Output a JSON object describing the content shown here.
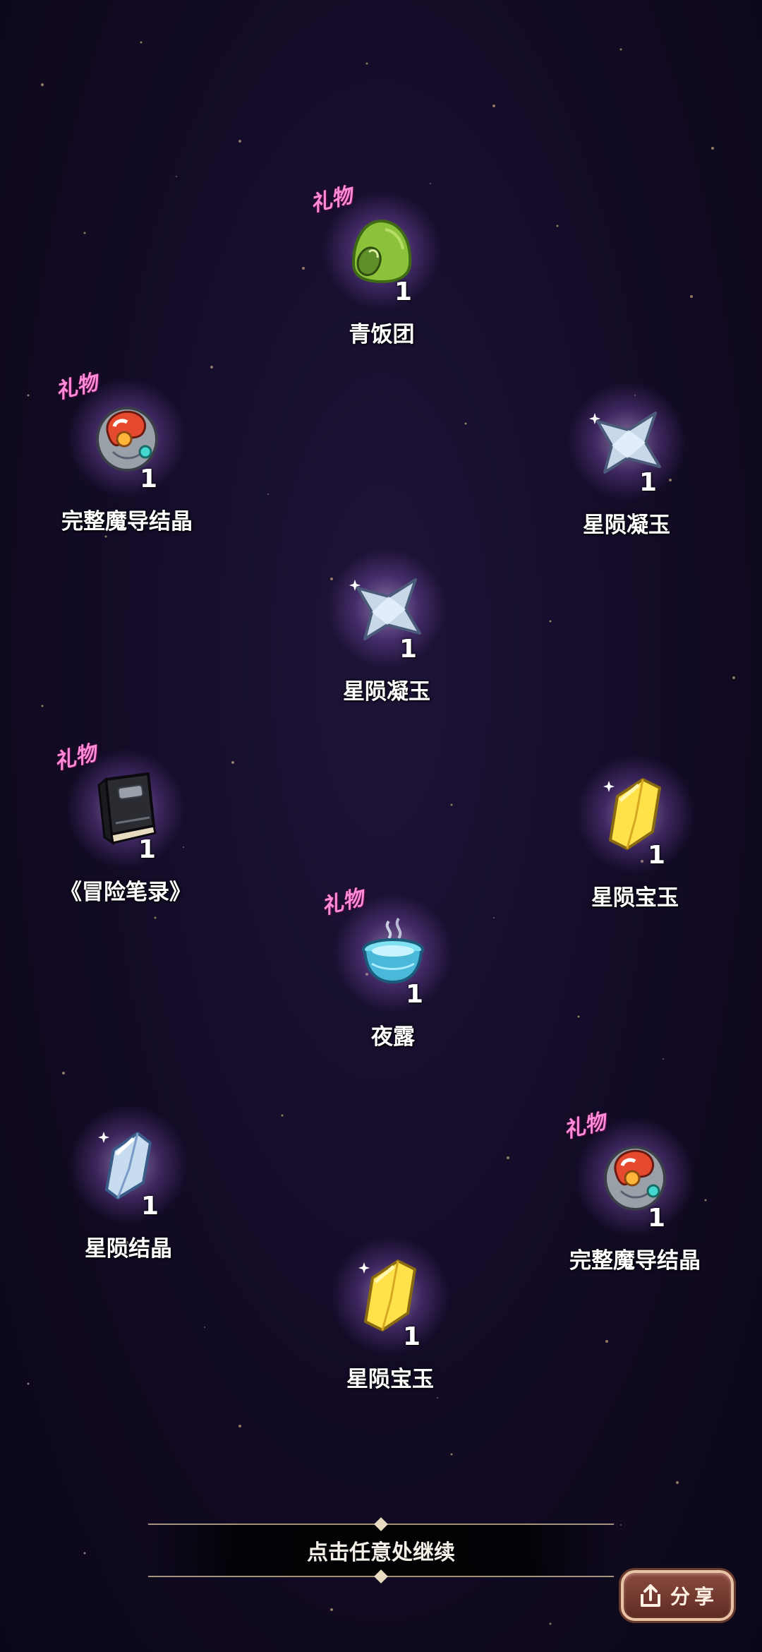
{
  "gift_label": "礼物",
  "items": [
    {
      "name": "青饭团",
      "count": "1",
      "gift": true,
      "icon": "green-rice-ball-icon"
    },
    {
      "name": "完整魔导结晶",
      "count": "1",
      "gift": true,
      "icon": "magic-crystal-orb-icon"
    },
    {
      "name": "星陨凝玉",
      "count": "1",
      "gift": false,
      "icon": "silver-star-gem-icon"
    },
    {
      "name": "星陨凝玉",
      "count": "1",
      "gift": false,
      "icon": "silver-star-gem-icon"
    },
    {
      "name": "《冒险笔录》",
      "count": "1",
      "gift": true,
      "icon": "black-book-icon"
    },
    {
      "name": "星陨宝玉",
      "count": "1",
      "gift": false,
      "icon": "yellow-gem-icon"
    },
    {
      "name": "夜露",
      "count": "1",
      "gift": true,
      "icon": "dew-cup-icon"
    },
    {
      "name": "星陨结晶",
      "count": "1",
      "gift": false,
      "icon": "blue-crystal-icon"
    },
    {
      "name": "完整魔导结晶",
      "count": "1",
      "gift": true,
      "icon": "magic-crystal-orb-icon"
    },
    {
      "name": "星陨宝玉",
      "count": "1",
      "gift": false,
      "icon": "yellow-gem-icon"
    }
  ],
  "continue_text": "点击任意处继续",
  "share_label": "分享",
  "colors": {
    "gift_tag": "#ff8ad8",
    "background": "#140c28",
    "share_button": "#6e3529"
  }
}
